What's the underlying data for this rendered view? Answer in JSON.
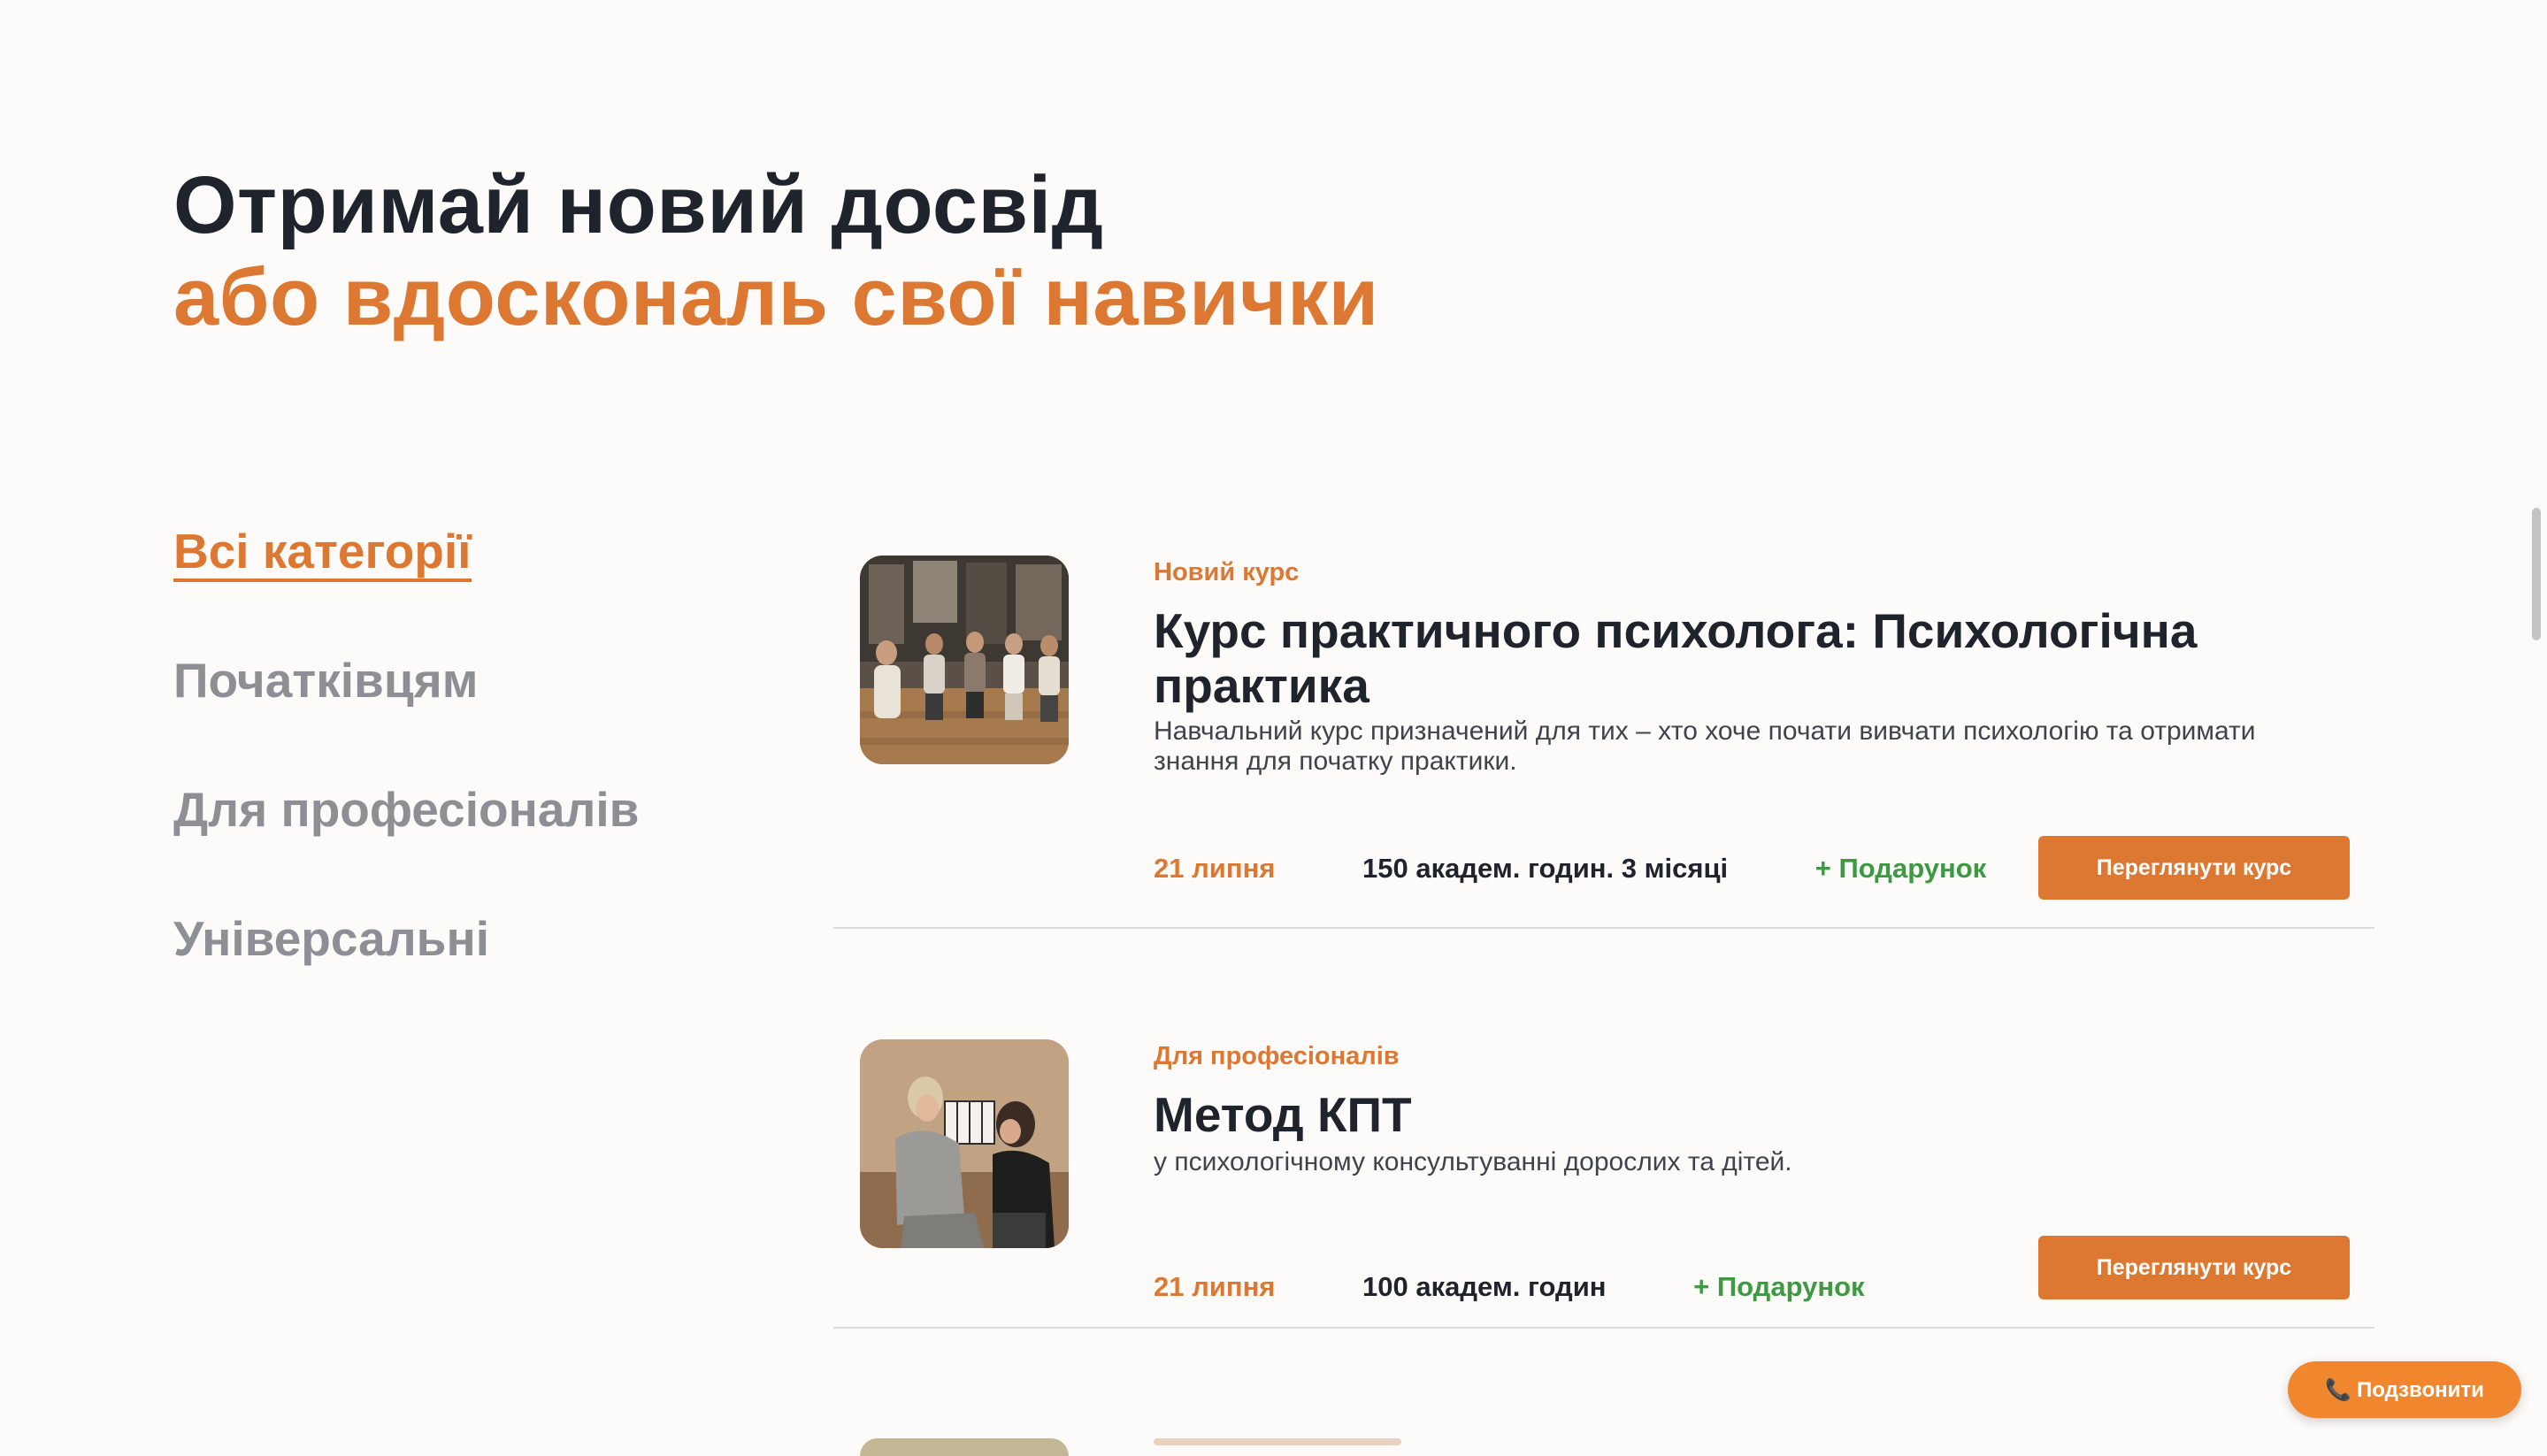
{
  "hero": {
    "title_line1": "Отримай новий досвід",
    "title_line2": "або вдоскональ свої навички"
  },
  "categories": [
    {
      "label": "Всі категорії",
      "active": true
    },
    {
      "label": "Початківцям",
      "active": false
    },
    {
      "label": "Для професіоналів",
      "active": false
    },
    {
      "label": "Універсальні",
      "active": false
    }
  ],
  "courses": [
    {
      "tag": "Новий курс",
      "title": "Курс практичного психолога: Психологічна практика",
      "description": "Навчальний курс призначений для тих – хто хоче почати вивчати психологію та отримати знання для початку практики.",
      "date": "21 липня",
      "hours": "150 академ. годин. 3 місяці",
      "gift": "+ Подарунок",
      "button": "Переглянути курс"
    },
    {
      "tag": "Для професіоналів",
      "title": "Метод КПТ",
      "description": "у психологічному консультуванні дорослих та дітей.",
      "date": "21 липня",
      "hours": "100 академ. годин",
      "gift": "+ Подарунок",
      "button": "Переглянути курс"
    }
  ],
  "call_button": {
    "icon": "phone-icon",
    "label": "Подзвонити"
  },
  "colors": {
    "accent": "#dc7832",
    "gift": "#3d9a43",
    "text": "#1f232b",
    "muted": "#8d8f94",
    "background": "#fdfbfa"
  }
}
